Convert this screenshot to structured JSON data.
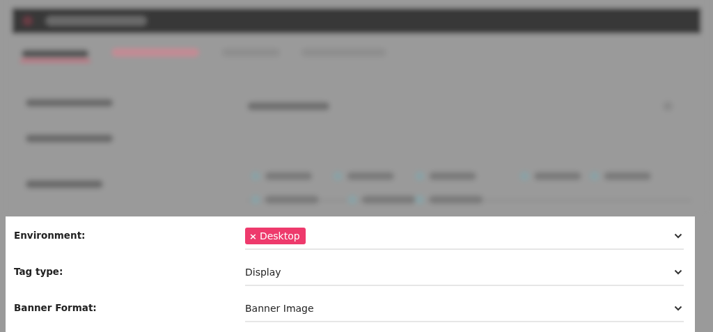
{
  "form": {
    "rows": [
      {
        "label": "Environment:",
        "kind": "tags",
        "tags": [
          {
            "remove": "×",
            "label": "Desktop"
          }
        ]
      },
      {
        "label": "Tag type:",
        "kind": "select",
        "value": "Display"
      },
      {
        "label": "Banner Format:",
        "kind": "select",
        "value": "Banner Image"
      }
    ]
  }
}
